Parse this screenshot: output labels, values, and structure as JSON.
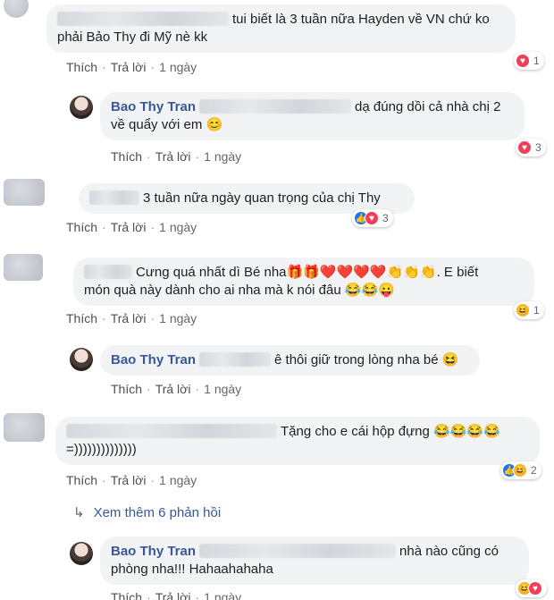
{
  "actions": {
    "like": "Thích",
    "reply": "Trả lời",
    "time": "1 ngày",
    "separator": "·"
  },
  "comments": [
    {
      "author": "",
      "text1": "tui biết là 3 tuần nữa Hayden về VN chứ ko",
      "text2": "phải Bảo Thy đi Mỹ nè kk",
      "reaction_count": "1"
    },
    {
      "author": "Bao Thy Tran",
      "text1": "dạ đúng dồi cả nhà chị 2",
      "text2": "về quẩy với em 😊",
      "reaction_count": "3"
    },
    {
      "author": "",
      "text1": "3 tuần nữa ngày quan trọng của chị Thy",
      "reaction_count": "3"
    },
    {
      "author": "",
      "text1": "Cưng quá nhất dì Bé nha🎁🎁❤️❤️❤️❤️👏👏👏. E biết",
      "text2": "món quà này dành cho ai nha mà k nói đâu 😂😂😛",
      "reaction_count": "1"
    },
    {
      "author": "Bao Thy Tran",
      "text1": "ê thôi giữ trong lòng nha bé 😆"
    },
    {
      "author": "",
      "text1": "Tặng cho e cái hộp đựng 😂😂😂😂",
      "text2": "=))))))))))))))",
      "reaction_count": "2"
    },
    {
      "author": "Bao Thy Tran",
      "text1": "nhà nào cũng có",
      "text2": "phòng nha!!! Hahaahahaha"
    }
  ],
  "view_more": "Xem thêm 6 phản hồi",
  "colors": {
    "link": "#385898",
    "bubble": "#f2f3f5",
    "heart": "#f33e58",
    "like": "#1877f2",
    "haha": "#f7b125"
  }
}
